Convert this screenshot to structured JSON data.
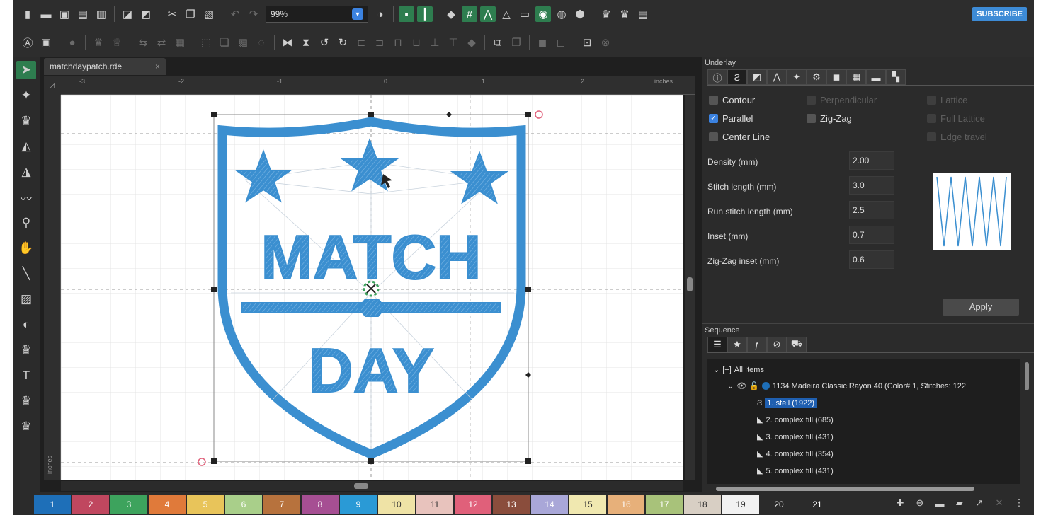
{
  "toolbar1": {
    "zoom": "99%",
    "subscribe_label": "SUBSCRIBE"
  },
  "document_tab": {
    "name": "matchdaypatch.rde",
    "close": "×"
  },
  "ruler": {
    "unit": "inches",
    "h_labels": [
      "-3",
      "-2",
      "-1",
      "0",
      "1",
      "2"
    ],
    "v_unit": "inches"
  },
  "canvas": {
    "design_text_top": "MATCH",
    "design_text_bottom": "DAY",
    "stitch_color": "#3b8fd0"
  },
  "underlay": {
    "title": "Underlay",
    "options": [
      {
        "label": "Contour",
        "checked": false,
        "enabled": true
      },
      {
        "label": "Perpendicular",
        "checked": false,
        "enabled": false
      },
      {
        "label": "Lattice",
        "checked": false,
        "enabled": false
      },
      {
        "label": "Parallel",
        "checked": true,
        "enabled": true
      },
      {
        "label": "Zig-Zag",
        "checked": false,
        "enabled": true
      },
      {
        "label": "Full Lattice",
        "checked": false,
        "enabled": false
      },
      {
        "label": "Center Line",
        "checked": false,
        "enabled": true
      },
      {
        "label": "Edge travel",
        "checked": false,
        "enabled": false
      }
    ],
    "fields": [
      {
        "label": "Density (mm)",
        "value": "2.00"
      },
      {
        "label": "Stitch length (mm)",
        "value": "3.0"
      },
      {
        "label": "Run stitch length (mm)",
        "value": "2.5"
      },
      {
        "label": "Inset (mm)",
        "value": "0.7"
      },
      {
        "label": "Zig-Zag inset (mm)",
        "value": "0.6"
      }
    ],
    "apply_label": "Apply"
  },
  "sequence": {
    "title": "Sequence",
    "root_label": "All Items",
    "thread_label": "1134 Madeira Classic Rayon 40 (Color# 1, Stitches: 122",
    "items": [
      {
        "label": "1. steil (1922)",
        "selected": true
      },
      {
        "label": "2. complex fill (685)",
        "selected": false
      },
      {
        "label": "3. complex fill (431)",
        "selected": false
      },
      {
        "label": "4. complex fill (354)",
        "selected": false
      },
      {
        "label": "5. complex fill (431)",
        "selected": false
      }
    ]
  },
  "palette": [
    {
      "num": "1",
      "color": "#1e6fb8"
    },
    {
      "num": "2",
      "color": "#c0475f"
    },
    {
      "num": "3",
      "color": "#3da35d"
    },
    {
      "num": "4",
      "color": "#e07a3a"
    },
    {
      "num": "5",
      "color": "#e8c45a"
    },
    {
      "num": "6",
      "color": "#a9cf8a"
    },
    {
      "num": "7",
      "color": "#b7723d"
    },
    {
      "num": "8",
      "color": "#a64f93"
    },
    {
      "num": "9",
      "color": "#2a9ad6"
    },
    {
      "num": "10",
      "color": "#efe3a6"
    },
    {
      "num": "11",
      "color": "#e8c3bd"
    },
    {
      "num": "12",
      "color": "#e0607a"
    },
    {
      "num": "13",
      "color": "#8a4d3c"
    },
    {
      "num": "14",
      "color": "#a9a7d8"
    },
    {
      "num": "15",
      "color": "#f0e8b0"
    },
    {
      "num": "16",
      "color": "#e7b07a"
    },
    {
      "num": "17",
      "color": "#a8c27a"
    },
    {
      "num": "18",
      "color": "#d8cfc4"
    },
    {
      "num": "19",
      "color": "#f2f2f2"
    },
    {
      "num": "20",
      "color": "#2b2b2b"
    },
    {
      "num": "21",
      "color": "#2b2b2b"
    }
  ]
}
